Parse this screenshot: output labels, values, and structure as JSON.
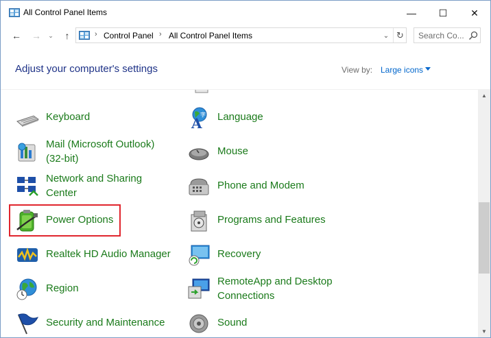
{
  "window": {
    "title": "All Control Panel Items",
    "minimize_glyph": "—",
    "maximize_glyph": "☐",
    "close_glyph": "✕"
  },
  "nav": {
    "back_glyph": "←",
    "forward_glyph": "→",
    "recent_glyph": "⌄",
    "up_glyph": "↑",
    "breadcrumbs": [
      "Control Panel",
      "All Control Panel Items"
    ],
    "crumb_separator": "›",
    "address_dropdown_glyph": "⌄",
    "refresh_glyph": "↻",
    "search_placeholder": "Search Co..."
  },
  "header": {
    "title": "Adjust your computer's settings",
    "view_by_label": "View by:",
    "view_by_value": "Large icons"
  },
  "items": {
    "left": [
      {
        "label": "Keyboard",
        "icon": "keyboard-icon"
      },
      {
        "label": "Mail (Microsoft Outlook) (32-bit)",
        "line1": "Mail (Microsoft Outlook)",
        "line2": "(32-bit)",
        "icon": "mail-icon"
      },
      {
        "label": "Network and Sharing Center",
        "line1": "Network and Sharing",
        "line2": "Center",
        "icon": "network-icon"
      },
      {
        "label": "Power Options",
        "icon": "power-options-icon"
      },
      {
        "label": "Realtek HD Audio Manager",
        "icon": "realtek-audio-icon"
      },
      {
        "label": "Region",
        "icon": "region-icon"
      },
      {
        "label": "Security and Maintenance",
        "icon": "security-flag-icon"
      }
    ],
    "right": [
      {
        "label": "Language",
        "icon": "language-icon"
      },
      {
        "label": "Mouse",
        "icon": "mouse-icon"
      },
      {
        "label": "Phone and Modem",
        "icon": "phone-icon"
      },
      {
        "label": "Programs and Features",
        "icon": "programs-icon"
      },
      {
        "label": "Recovery",
        "icon": "recovery-icon"
      },
      {
        "label": "RemoteApp and Desktop Connections",
        "line1": "RemoteApp and Desktop",
        "line2": "Connections",
        "icon": "remoteapp-icon"
      },
      {
        "label": "Sound",
        "icon": "sound-icon"
      }
    ]
  },
  "scrollbar": {
    "up_glyph": "▲",
    "down_glyph": "▼",
    "position_fraction": 0.72
  },
  "colors": {
    "link_green": "#1a7a1a",
    "title_blue": "#1e3287",
    "accent_blue": "#0066cc",
    "highlight_red": "#e0242c"
  }
}
